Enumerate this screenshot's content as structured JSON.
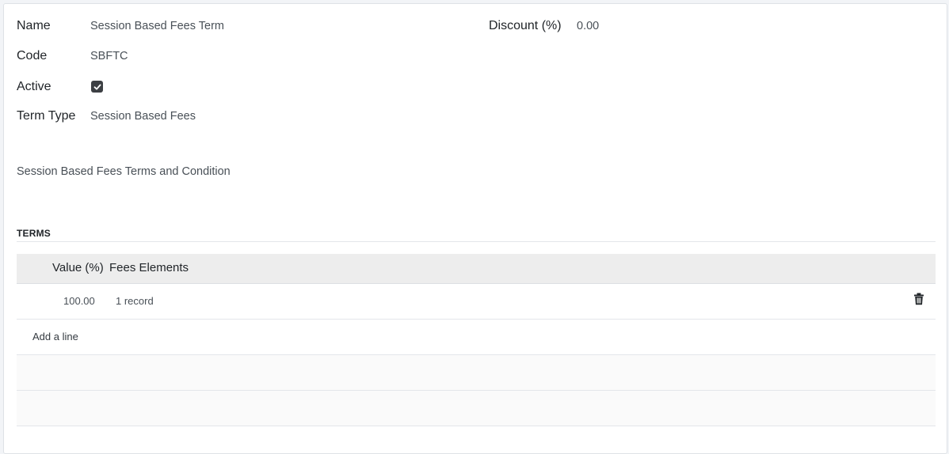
{
  "form": {
    "name_label": "Name",
    "name_value": "Session Based Fees Term",
    "code_label": "Code",
    "code_value": "SBFTC",
    "active_label": "Active",
    "active_checked": true,
    "term_type_label": "Term Type",
    "term_type_value": "Session Based Fees",
    "discount_label": "Discount (%)",
    "discount_value": "0.00",
    "terms_text": "Session Based Fees Terms and Condition"
  },
  "terms": {
    "section_title": "TERMS",
    "columns": [
      "Value (%)",
      "Fees Elements"
    ],
    "rows": [
      {
        "value": "100.00",
        "fees_elements": "1 record",
        "delete_icon": "trash-icon"
      }
    ],
    "add_line_label": "Add a line"
  },
  "colors": {
    "checkbox_bg": "#3c3f43",
    "header_bg": "#ededed",
    "sheet_bg": "#ffffff"
  }
}
